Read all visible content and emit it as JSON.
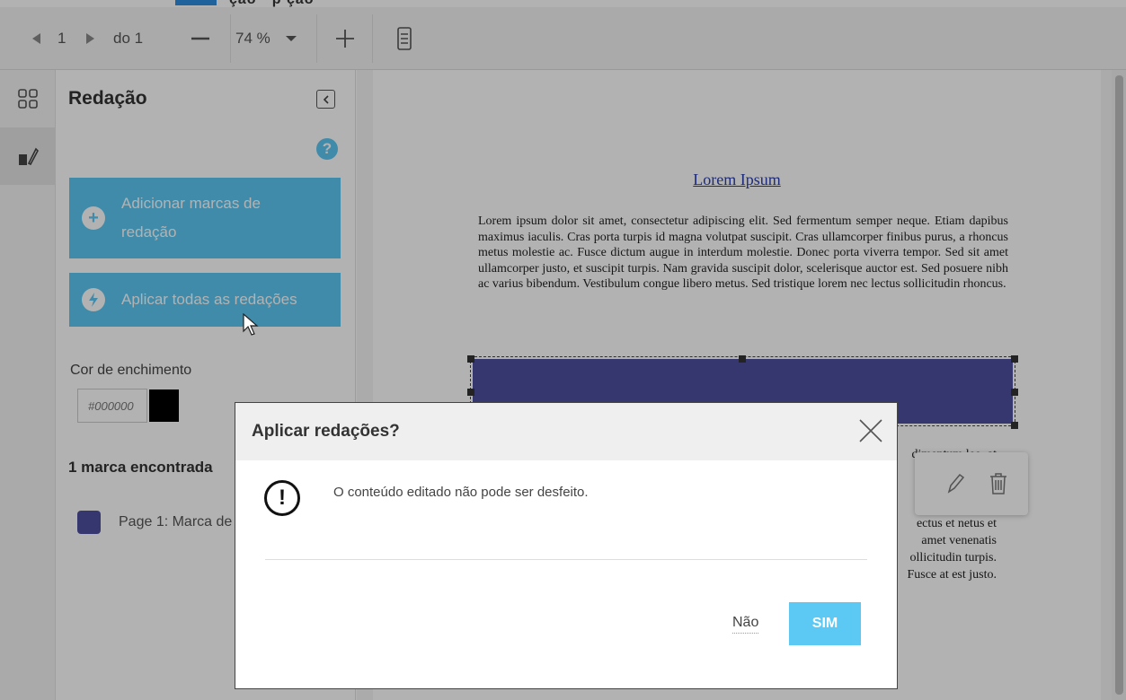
{
  "window": {
    "title_fragment": "ção · p    ção"
  },
  "toolbar": {
    "prev_icon": "triangle-left-icon",
    "page_current": "1",
    "next_icon": "triangle-right-icon",
    "page_of": "do 1",
    "zoom_out_icon": "minus-icon",
    "zoom_value": "74 %",
    "zoom_in_icon": "plus-icon",
    "fit_icon": "fit-page-icon"
  },
  "rail": {
    "thumbnails_icon": "grid-icon",
    "redaction_icon": "redaction-tool-icon"
  },
  "panel": {
    "title": "Redação",
    "add_marks_label": "Adicionar marcas de redação",
    "apply_all_label": "Aplicar todas as redações",
    "fill_color_label": "Cor de enchimento",
    "fill_color_value": "#000000",
    "found_label": "1 marca encontrada",
    "mark_item_label": "Page 1: Marca de",
    "mark_color": "#5050a0"
  },
  "document": {
    "title": "Lorem Ipsum",
    "paragraph": "Lorem ipsum dolor sit amet, consectetur adipiscing elit. Sed fermentum semper neque. Etiam dapibus maximus iaculis. Cras porta turpis id magna volutpat suscipit. Cras ullamcorper finibus purus, a rhoncus metus molestie ac. Fusce dictum augue in interdum molestie. Donec porta viverra tempor. Sed sit amet ullamcorper justo, et suscipit turpis. Nam gravida suscipit dolor, scelerisque auctor est. Sed posuere nibh ac varius bibendum. Vestibulum congue libero metus. Sed tristique lorem nec lectus sollicitudin rhoncus.",
    "frag1": "dimentum leo, at",
    "frag2": "ectus et netus et",
    "frag3": "amet venenatis",
    "frag4": "ollicitudin turpis.",
    "frag5": "Fusce at est justo."
  },
  "dialog": {
    "title": "Aplicar redações?",
    "message": "O conteúdo editado não pode ser desfeito.",
    "no_label": "Não",
    "yes_label": "SIM"
  },
  "colors": {
    "accent": "#5cc8f4",
    "redaction": "#5050a0"
  }
}
